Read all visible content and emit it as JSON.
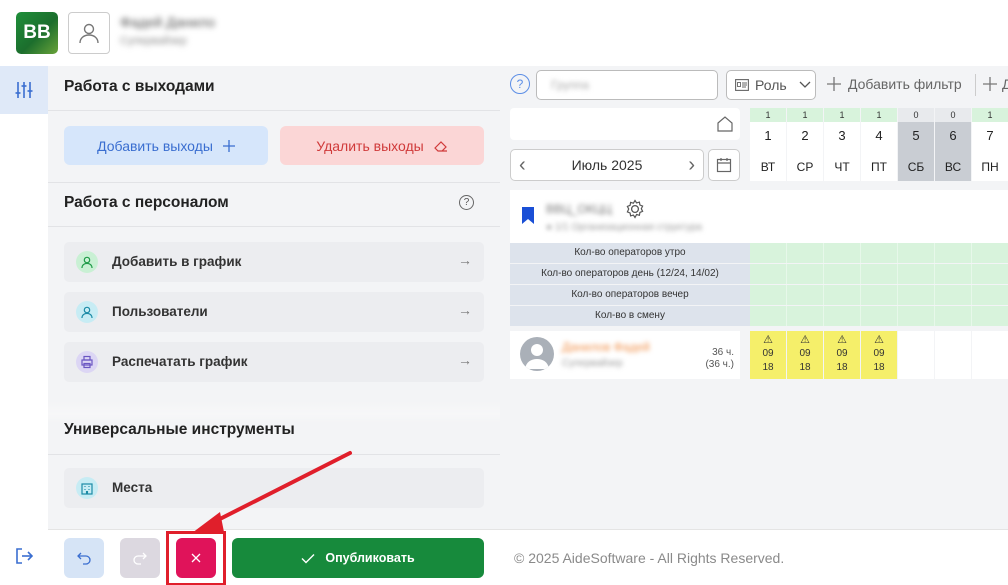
{
  "header": {
    "logo_text": "BB",
    "user_name": "Фадей Данило",
    "user_role": "Супервайзер"
  },
  "panel": {
    "outputs_title": "Работа с выходами",
    "add_outputs_label": "Добавить выходы",
    "delete_outputs_label": "Удалить выходы",
    "staff_title": "Работа с персоналом",
    "help_glyph": "?",
    "staff_items": [
      {
        "label": "Добавить в график"
      },
      {
        "label": "Пользователи"
      },
      {
        "label": "Распечатать график"
      }
    ],
    "tools_title": "Универсальные инструменты",
    "tools_items": [
      {
        "label": "Места"
      }
    ],
    "arrow_glyph": "→"
  },
  "bottom": {
    "publish_label": "Опубликовать",
    "copyright": "© 2025 AideSoftware - All Rights Reserved."
  },
  "schedule": {
    "info_glyph": "?",
    "search_placeholder": "Группа",
    "role_label": "Роль",
    "add_filter_label": "Добавить фильтр",
    "add_filter_label_2": "Д",
    "month_label": "Июль 2025",
    "prev_glyph": "‹",
    "next_glyph": "›",
    "days": [
      {
        "count": "1",
        "num": "1",
        "weekday": "ВТ",
        "weekend": false
      },
      {
        "count": "1",
        "num": "2",
        "weekday": "СР",
        "weekend": false
      },
      {
        "count": "1",
        "num": "3",
        "weekday": "ЧТ",
        "weekend": false
      },
      {
        "count": "1",
        "num": "4",
        "weekday": "ПТ",
        "weekend": false
      },
      {
        "count": "0",
        "num": "5",
        "weekday": "СБ",
        "weekend": true
      },
      {
        "count": "0",
        "num": "6",
        "weekday": "ВС",
        "weekend": true
      },
      {
        "count": "1",
        "num": "7",
        "weekday": "ПН",
        "weekend": false
      }
    ],
    "group_name": "ВВЦ_ОКЦЦ",
    "group_sub": "● 1/1 Организационная структура",
    "metrics": [
      "Кол-во операторов утро",
      "Кол-во операторов день (12/24, 14/02)",
      "Кол-во операторов вечер",
      "Кол-во в смену"
    ],
    "employee": {
      "name": "Данилов Фадей",
      "role": "Супервайзер",
      "hours": "36 ч.",
      "hours_paren": "(36 ч.)"
    },
    "shifts": [
      {
        "warn": "⚠",
        "start": "09",
        "end": "18"
      },
      {
        "warn": "⚠",
        "start": "09",
        "end": "18"
      },
      {
        "warn": "⚠",
        "start": "09",
        "end": "18"
      },
      {
        "warn": "⚠",
        "start": "09",
        "end": "18"
      }
    ]
  },
  "colors": {
    "accent_blue": "#3a6ed0",
    "danger": "#e0135a",
    "publish_green": "#178a3c",
    "shift_yellow": "#f5ef6a",
    "annotation_red": "#e01f2b"
  }
}
